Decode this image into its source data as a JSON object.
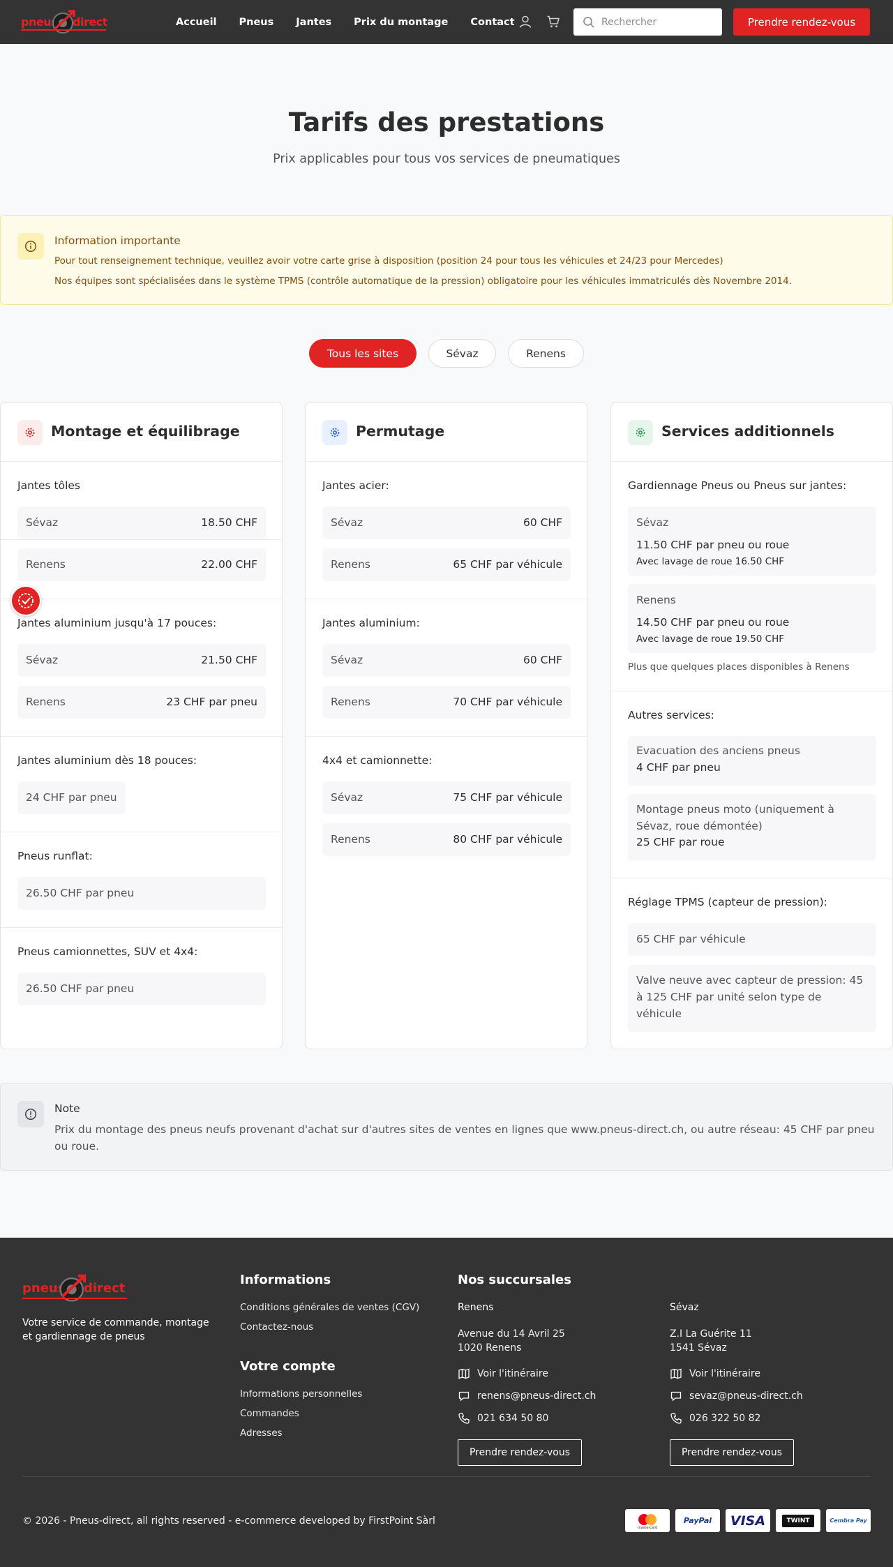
{
  "header": {
    "logo_left": "pneus",
    "logo_right": "direct",
    "nav": [
      "Accueil",
      "Pneus",
      "Jantes",
      "Prix du montage",
      "Contact"
    ],
    "search_placeholder": "Rechercher",
    "cta": "Prendre rendez-vous",
    "icons": [
      "user-icon",
      "cart-icon",
      "search-icon"
    ]
  },
  "hero": {
    "title": "Tarifs des prestations",
    "subtitle": "Prix applicables pour tous vos services de pneumatiques"
  },
  "info": {
    "title": "Information importante",
    "line1": "Pour tout renseignement technique, veuillez avoir votre carte grise à disposition (position 24 pour tous les véhicules et 24/23 pour Mercedes)",
    "line2": "Nos équipes sont spécialisées dans le système TPMS (contrôle automatique de la pression) obligatoire pour les véhicules immatriculés dès Novembre 2014."
  },
  "filters": [
    "Tous les sites",
    "Sévaz",
    "Renens"
  ],
  "cards": {
    "montage": {
      "title": "Montage et équilibrage",
      "s1": {
        "title": "Jantes tôles",
        "rows": [
          {
            "k": "Sévaz",
            "v": "18.50 CHF"
          },
          {
            "k": "Renens",
            "v": "22.00 CHF"
          }
        ]
      },
      "s2": {
        "title": "Jantes aluminium jusqu'à 17 pouces:",
        "rows": [
          {
            "k": "Sévaz",
            "v": "21.50 CHF"
          },
          {
            "k": "Renens",
            "v": "23 CHF par pneu"
          }
        ]
      },
      "s3": {
        "title": "Jantes aluminium dès 18 pouces:",
        "chip": "24 CHF par pneu"
      },
      "s4": {
        "title": "Pneus runflat:",
        "chip": "26.50 CHF par pneu"
      },
      "s5": {
        "title": "Pneus camionnettes, SUV et 4x4:",
        "chip": "26.50 CHF par pneu"
      }
    },
    "permutage": {
      "title": "Permutage",
      "s1": {
        "title": "Jantes acier:",
        "rows": [
          {
            "k": "Sévaz",
            "v": "60 CHF"
          },
          {
            "k": "Renens",
            "v": "65 CHF par véhicule"
          }
        ]
      },
      "s2": {
        "title": "Jantes aluminium:",
        "rows": [
          {
            "k": "Sévaz",
            "v": "60 CHF"
          },
          {
            "k": "Renens",
            "v": "70 CHF par véhicule"
          }
        ]
      },
      "s3": {
        "title": "4x4 et camionnette:",
        "rows": [
          {
            "k": "Sévaz",
            "v": "75 CHF par véhicule"
          },
          {
            "k": "Renens",
            "v": "80 CHF par véhicule"
          }
        ]
      }
    },
    "services": {
      "title": "Services additionnels",
      "s1": {
        "title": "Gardiennage Pneus ou Pneus sur jantes:",
        "boxes": [
          {
            "site": "Sévaz",
            "price": "11.50 CHF par pneu ou roue",
            "extra": "Avec lavage de roue 16.50 CHF"
          },
          {
            "site": "Renens",
            "price": "14.50 CHF par pneu ou roue",
            "extra": "Avec lavage de roue 19.50 CHF"
          }
        ],
        "note": "Plus que quelques places disponibles à Renens"
      },
      "s2": {
        "title": "Autres services:",
        "b1": {
          "label": "Evacuation des anciens pneus",
          "price": "4 CHF par pneu"
        },
        "b2": {
          "label": "Montage pneus moto (uniquement à Sévaz, roue démontée)",
          "price": "25 CHF par roue"
        }
      },
      "s3": {
        "title": "Réglage TPMS (capteur de pression):",
        "chip": "65 CHF par véhicule",
        "box": "Valve neuve avec capteur de pression: 45 à 125 CHF par unité selon type de véhicule"
      }
    }
  },
  "note": {
    "title": "Note",
    "body": "Prix du montage des pneus neufs provenant d'achat sur d'autres sites de ventes en lignes que www.pneus-direct.ch, ou autre réseau: 45 CHF par pneu ou roue."
  },
  "footer": {
    "tagline": "Votre service de commande, montage et gardiennage de pneus",
    "info_title": "Informations",
    "info_links": [
      "Conditions générales de ventes (CGV)",
      "Contactez-nous"
    ],
    "account_title": "Votre compte",
    "account_links": [
      "Informations personnelles",
      "Commandes",
      "Adresses"
    ],
    "branches_title": "Nos succursales",
    "branches": [
      {
        "name": "Renens",
        "addr1": "Avenue du 14 Avril 25",
        "addr2": "1020 Renens",
        "route": "Voir l'itinéraire",
        "email": "renens@pneus-direct.ch",
        "phone": "021 634 50 80",
        "cta": "Prendre rendez-vous"
      },
      {
        "name": "Sévaz",
        "addr1": "Z.I La Guérite 11",
        "addr2": "1541 Sévaz",
        "route": "Voir l'itinéraire",
        "email": "sevaz@pneus-direct.ch",
        "phone": "026 322 50 82",
        "cta": "Prendre rendez-vous"
      }
    ],
    "copyright": "© 2026 - Pneus-direct, all rights reserved - e-commerce developed by FirstPoint Sàrl",
    "payments": [
      "mastercard",
      "PayPal",
      "VISA",
      "TWINT",
      "Cembra Pay"
    ]
  },
  "colors": {
    "brand_red": "#e02424",
    "header_bg": "#333333",
    "info_bg": "#fefce8",
    "info_text": "#874d09",
    "icon_blue": "#2563eb",
    "icon_green": "#16a34a"
  }
}
